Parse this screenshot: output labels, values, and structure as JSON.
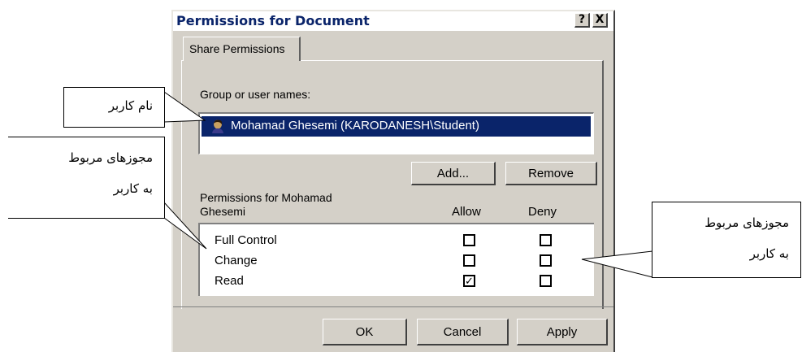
{
  "dialog": {
    "title": "Permissions for Document",
    "help_glyph": "?",
    "close_glyph": "X",
    "tab_label": "Share Permissions",
    "group_label": "Group or user names:",
    "user_entry": "Mohamad Ghesemi (KARODANESH\\Student)",
    "add_label": "Add...",
    "remove_label": "Remove",
    "permissions_label_line1": "Permissions for Mohamad",
    "permissions_label_line2": "Ghesemi",
    "allow_header": "Allow",
    "deny_header": "Deny",
    "permissions": [
      {
        "name": "Full Control",
        "allow": false,
        "deny": false
      },
      {
        "name": "Change",
        "allow": false,
        "deny": false
      },
      {
        "name": "Read",
        "allow": true,
        "deny": false
      }
    ],
    "check_glyph": "✓",
    "ok_label": "OK",
    "cancel_label": "Cancel",
    "apply_label": "Apply"
  },
  "callouts": {
    "username": "نام کاربر",
    "left_permissions_line1": "مجوزهای مربوط",
    "left_permissions_line2": "به کاربر",
    "right_permissions_line1": "مجوزهای مربوط",
    "right_permissions_line2": "به کاربر"
  },
  "colors": {
    "dialog_bg": "#d4d0c8",
    "title_text": "#0a246a",
    "selection_bg": "#0a246a"
  }
}
